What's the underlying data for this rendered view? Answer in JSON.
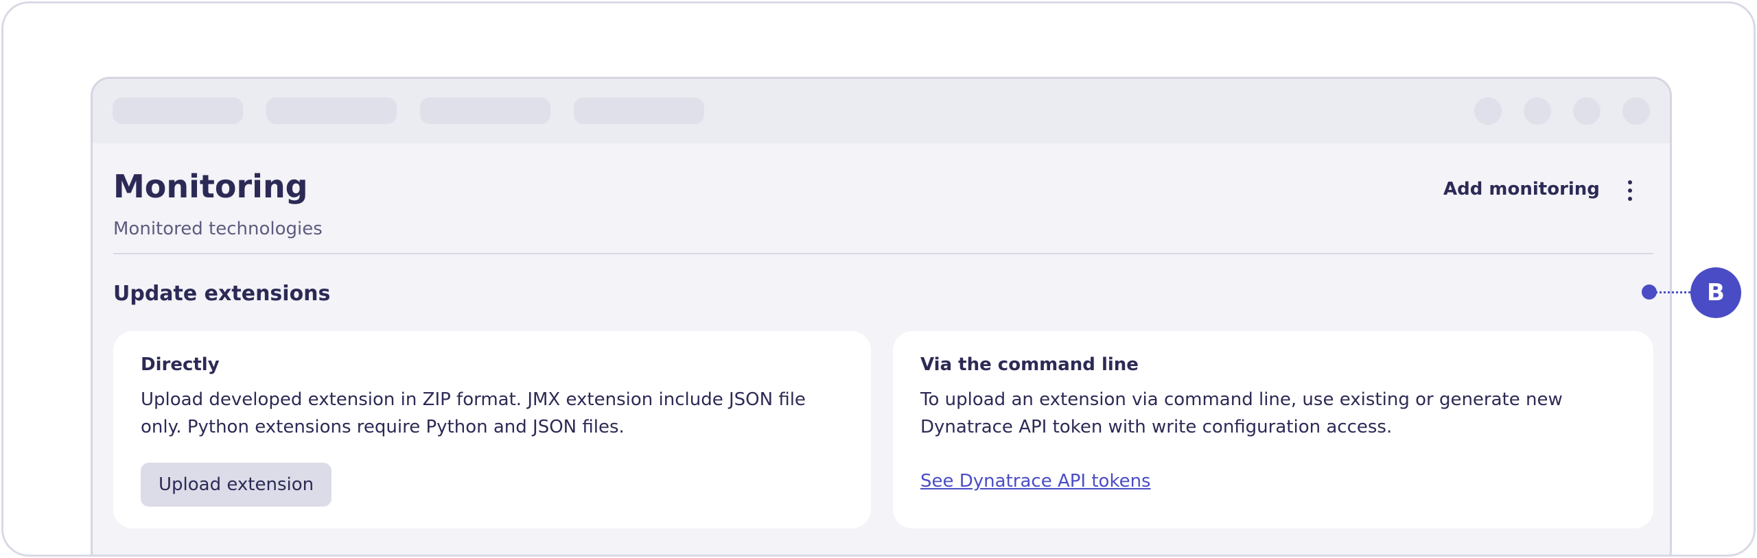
{
  "header": {
    "title": "Monitoring",
    "subtitle": "Monitored technologies",
    "add_monitoring_label": "Add monitoring"
  },
  "section": {
    "title": "Update extensions"
  },
  "cards": {
    "direct": {
      "heading": "Directly",
      "body": "Upload developed extension in ZIP format. JMX extension include JSON file only. Python extensions require Python and JSON files.",
      "button_label": "Upload extension"
    },
    "cli": {
      "heading": "Via the command line",
      "body": "To upload an extension via command line, use existing or generate new Dynatrace API token with write configuration access.",
      "link_label": "See Dynatrace API tokens"
    }
  },
  "callout": {
    "label": "B"
  },
  "colors": {
    "accent": "#4a4cc6",
    "text": "#2c2a55",
    "background": "#f3f3f8"
  },
  "icons": {
    "menu": "more-vertical-icon"
  }
}
